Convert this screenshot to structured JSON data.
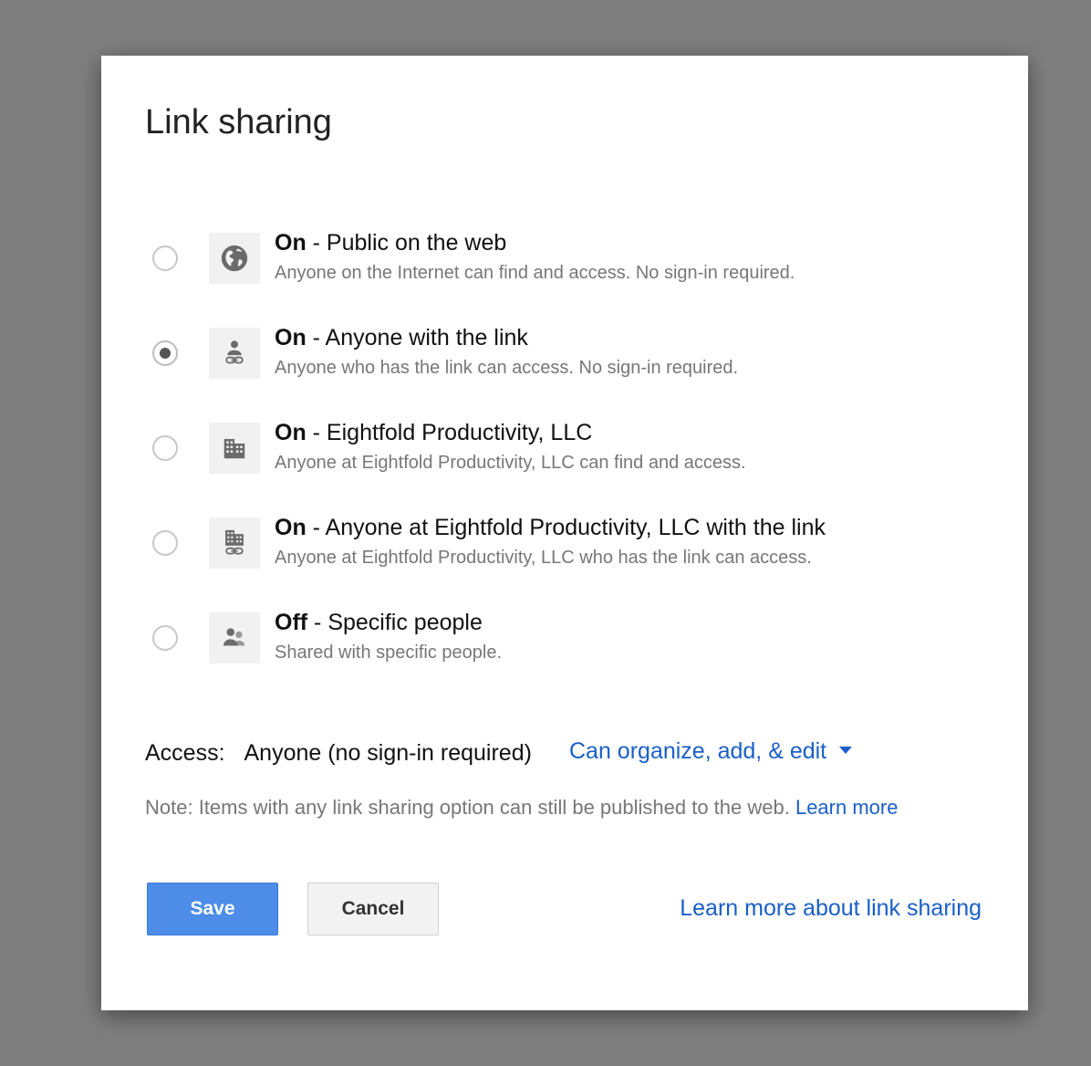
{
  "dialog": {
    "title": "Link sharing"
  },
  "options": [
    {
      "icon": "globe-icon",
      "state": "On",
      "label": " - Public on the web",
      "description": "Anyone on the Internet can find and access. No sign-in required.",
      "selected": false
    },
    {
      "icon": "person-link-icon",
      "state": "On",
      "label": " - Anyone with the link",
      "description": "Anyone who has the link can access. No sign-in required.",
      "selected": true
    },
    {
      "icon": "building-icon",
      "state": "On",
      "label": " - Eightfold Productivity, LLC",
      "description": "Anyone at Eightfold Productivity, LLC can find and access.",
      "selected": false
    },
    {
      "icon": "building-link-icon",
      "state": "On",
      "label": " - Anyone at Eightfold Productivity, LLC with the link",
      "description": "Anyone at Eightfold Productivity, LLC who has the link can access.",
      "selected": false
    },
    {
      "icon": "people-icon",
      "state": "Off",
      "label": " - Specific people",
      "description": "Shared with specific people.",
      "selected": false
    }
  ],
  "access": {
    "label": "Access:",
    "value": "Anyone (no sign-in required)",
    "permission": "Can organize, add, & edit"
  },
  "note": {
    "text": "Note: Items with any link sharing option can still be published to the web. ",
    "link": "Learn more"
  },
  "buttons": {
    "save": "Save",
    "cancel": "Cancel"
  },
  "footer_link": "Learn more about link sharing",
  "colors": {
    "link": "#1a5fc8",
    "primary_button": "#4d8de8",
    "backdrop": "#7f7f7f"
  }
}
